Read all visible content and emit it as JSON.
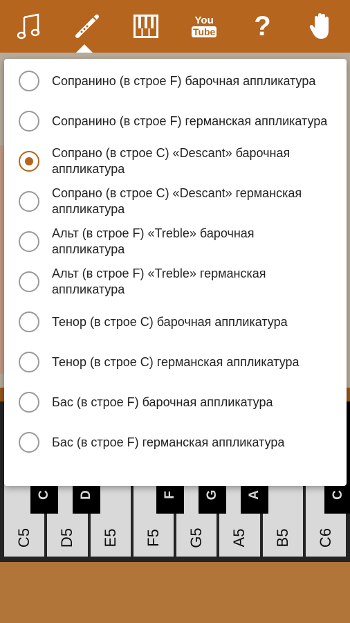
{
  "toolbar": {
    "icons": [
      "music-notes-icon",
      "recorder-icon",
      "piano-icon",
      "youtube-icon",
      "help-icon",
      "hand-icon"
    ],
    "youtube_top": "You",
    "youtube_bottom": "Tube",
    "help_glyph": "?",
    "selected": "recorder-icon",
    "color": "#b5651d"
  },
  "dialog": {
    "options": [
      {
        "label": "Сопранино (в строе F) барочная аппликатура",
        "checked": false
      },
      {
        "label": "Сопранино (в строе F) германская аппликатура",
        "checked": false
      },
      {
        "label": "Сопрано (в строе C) «Descant» барочная аппликатура",
        "checked": true
      },
      {
        "label": "Сопрано (в строе C) «Descant» германская аппликатура",
        "checked": false
      },
      {
        "label": "Альт (в строе F) «Treble» барочная аппликатура",
        "checked": false
      },
      {
        "label": "Альт (в строе F) «Treble» германская аппликатура",
        "checked": false
      },
      {
        "label": "Тенор (в строе C) барочная аппликатура",
        "checked": false
      },
      {
        "label": "Тенор (в строе C) германская аппликатура",
        "checked": false
      },
      {
        "label": "Бас (в строе F) барочная аппликатура",
        "checked": false
      },
      {
        "label": "Бас (в строе F) германская аппликатура",
        "checked": false
      }
    ],
    "accent_color": "#b5651d"
  },
  "keyboard": {
    "white_keys": [
      "C5",
      "D5",
      "E5",
      "F5",
      "G5",
      "A5",
      "B5",
      "C6"
    ],
    "black_keys": [
      "C",
      "D",
      "F",
      "G",
      "A",
      "C"
    ]
  }
}
